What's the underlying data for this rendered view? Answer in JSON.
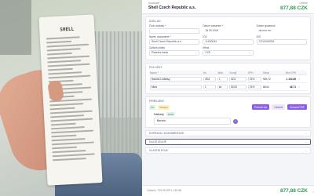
{
  "header": {
    "supplier_label": "Dodavatel",
    "company": "Shell Czech Republic a.s.",
    "total_label": "Celkem",
    "total": "877,88 CZK"
  },
  "doklad": {
    "title": "DOKLAD",
    "fields": [
      {
        "label": "Číslo dokladu *",
        "value": ""
      },
      {
        "label": "Datum vystavení *",
        "value": "18.09.2024"
      },
      {
        "label": "Datum splatnosti",
        "value": "dd.mm.rrrr"
      }
    ],
    "fields2": [
      {
        "label": "Název dodavatele *",
        "value": "Shell Czech Republic a.s."
      },
      {
        "label": "IČO",
        "value": "11000034"
      },
      {
        "label": "DIČ",
        "value": "CZ10000034"
      }
    ],
    "fields3": [
      {
        "label": "Způsob platby",
        "value": "Platební karta"
      },
      {
        "label": "Měna",
        "value": "CZK"
      }
    ]
  },
  "polozky": {
    "title": "POLOŽKY",
    "columns": [
      "Název *",
      "Ks",
      "Jedn.",
      "Cena/j.",
      "DPH",
      "Sleva",
      "Bez DPH"
    ],
    "rows": [
      {
        "name": "Natural Ludslavy",
        "qty": "28,6",
        "unit": "L",
        "price": "32,5",
        "vat": "21%",
        "discount": "",
        "subtotal": "929,72",
        "total": "1 102,68"
      },
      {
        "name": "Mina",
        "qty": "1",
        "unit": "ks",
        "price": "53,00",
        "vat": "21%",
        "discount": "",
        "subtotal": "86,61",
        "total": "46,71"
      }
    ]
  },
  "prirazeni": {
    "title": "PŘIŘAZENÍ",
    "status_chip": "OK",
    "state_chip": "Čekající",
    "btn_approve": "Potvrdit vše",
    "btn_history": "Historie",
    "btn_pdf": "Zobrazit PDF",
    "payment_label": "Náklady",
    "payment_pct": "100%",
    "payment_value": "Benzin"
  },
  "collapsed": [
    {
      "label": "DOPRAVA / DOKUMENTACE",
      "active": false
    },
    {
      "label": "DALŠÍ ÚDAJE",
      "active": true
    },
    {
      "label": "VLASTNÍ POLE",
      "active": false
    }
  ],
  "footer": {
    "summary": "Celkem: 729,06   DPH: 152,86",
    "total": "877,88 CZK",
    "edge": "‹"
  },
  "photo": {
    "receipt_title": "SHELL"
  },
  "colors": {
    "accent": "#8d5ce8",
    "total_green": "#2f9a55"
  }
}
